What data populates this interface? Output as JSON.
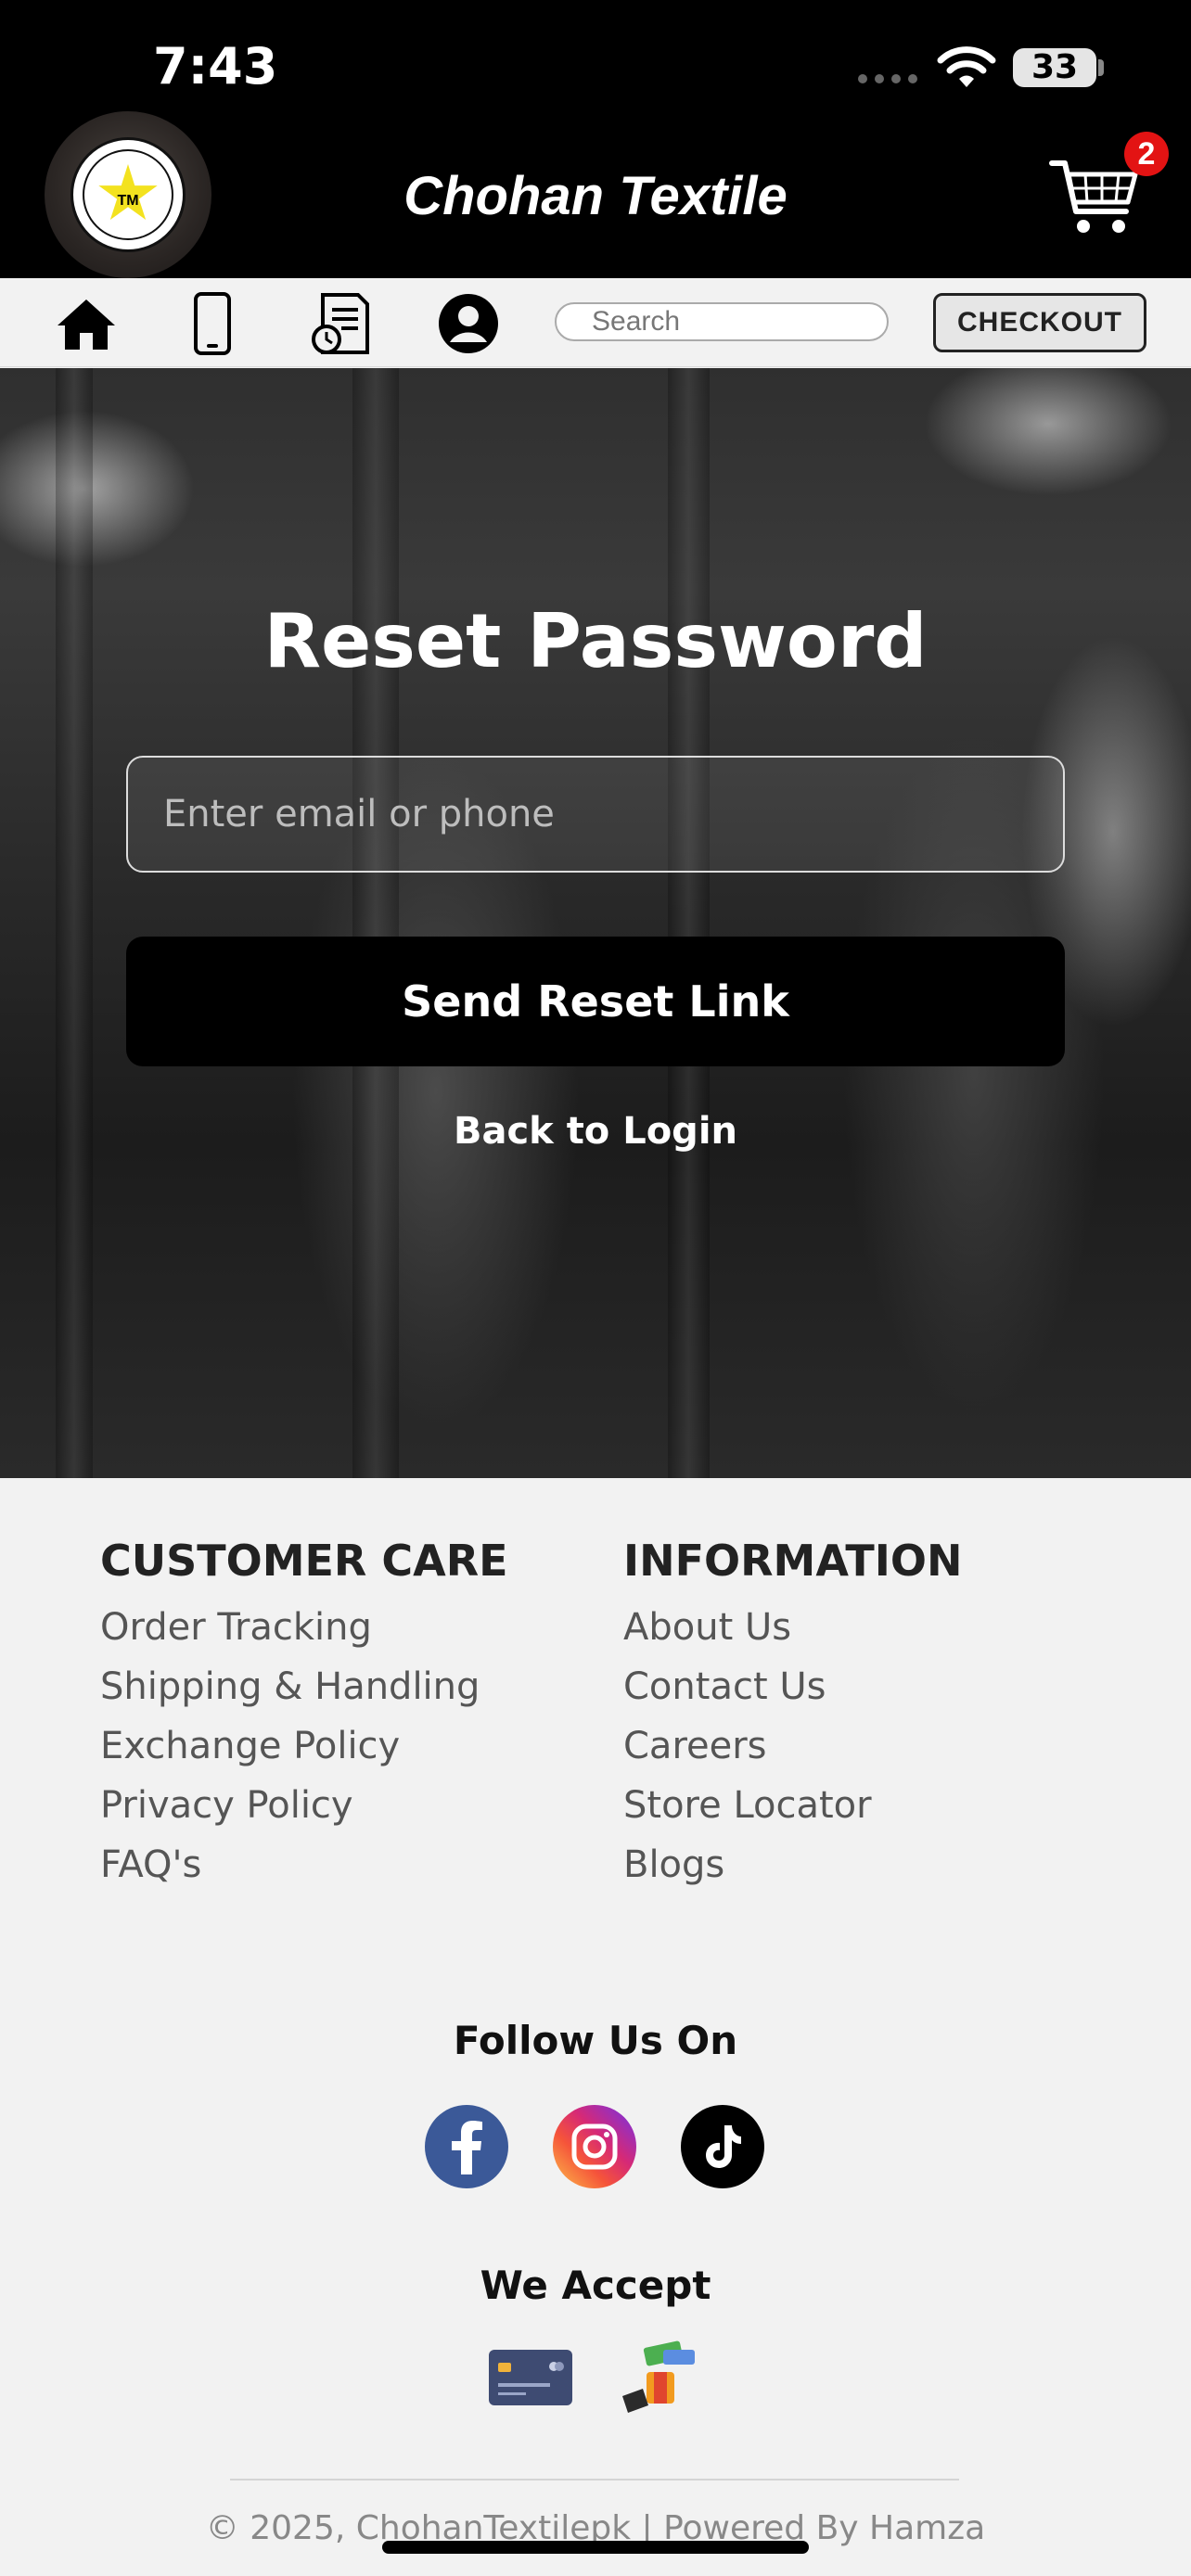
{
  "status_bar": {
    "time": "7:43",
    "battery": "33"
  },
  "header": {
    "brand_title": "Chohan Textile",
    "cart_count": "2",
    "logo_text": "TM"
  },
  "nav": {
    "search_placeholder": "Search",
    "checkout_label": "CHECKOUT",
    "icons": [
      "home-icon",
      "phone-icon",
      "order-history-icon",
      "user-account-icon"
    ]
  },
  "hero": {
    "title": "Reset Password",
    "email_placeholder": "Enter email or phone",
    "send_button": "Send Reset Link",
    "back_link": "Back to Login"
  },
  "footer": {
    "customer_care": {
      "title": "CUSTOMER CARE",
      "links": [
        "Order Tracking",
        "Shipping & Handling",
        "Exchange Policy",
        "Privacy Policy",
        "FAQ's"
      ]
    },
    "information": {
      "title": "INFORMATION",
      "links": [
        "About Us",
        "Contact Us",
        "Careers",
        "Store Locator",
        "Blogs"
      ]
    },
    "follow_title": "Follow Us On",
    "social": [
      "facebook-icon",
      "instagram-icon",
      "tiktok-icon"
    ],
    "accept_title": "We Accept",
    "payments": [
      "credit-card-icon",
      "cash-payment-icon"
    ],
    "copyright": "© 2025, ChohanTextilepk | Powered By Hamza"
  },
  "colors": {
    "badge": "#e31313",
    "facebook": "#3b5998",
    "header_bg": "#000000"
  }
}
